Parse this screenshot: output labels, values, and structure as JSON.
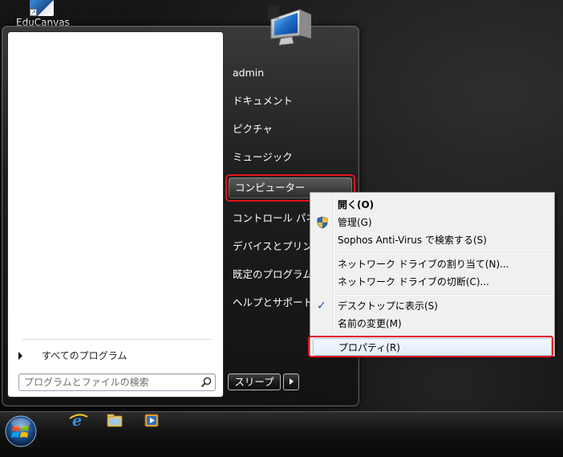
{
  "desktop": {
    "icon_label": "EduCanvas"
  },
  "start_menu": {
    "all_programs": "すべてのプログラム",
    "search_placeholder": "プログラムとファイルの検索",
    "right_items": [
      "admin",
      "ドキュメント",
      "ピクチャ",
      "ミュージック",
      "コンピューター",
      "コントロール パネル",
      "デバイスとプリンター",
      "既定のプログラム",
      "ヘルプとサポート"
    ],
    "sleep_label": "スリープ"
  },
  "context_menu": {
    "items": [
      "開く(O)",
      "管理(G)",
      "Sophos Anti-Virus で検索する(S)",
      "ネットワーク ドライブの割り当て(N)...",
      "ネットワーク ドライブの切断(C)...",
      "デスクトップに表示(S)",
      "名前の変更(M)",
      "プロパティ(R)"
    ]
  },
  "colors": {
    "highlight_red": "#e2131c",
    "menu_hover": "#e3eefa"
  },
  "icons": {
    "desktop": "educanvas-shortcut-icon",
    "start_menu_picture": "computer-icon",
    "taskbar": [
      "internet-explorer-icon",
      "explorer-folder-icon",
      "media-player-icon"
    ],
    "context_menu": [
      "uac-shield-icon",
      "checkmark-icon"
    ]
  }
}
